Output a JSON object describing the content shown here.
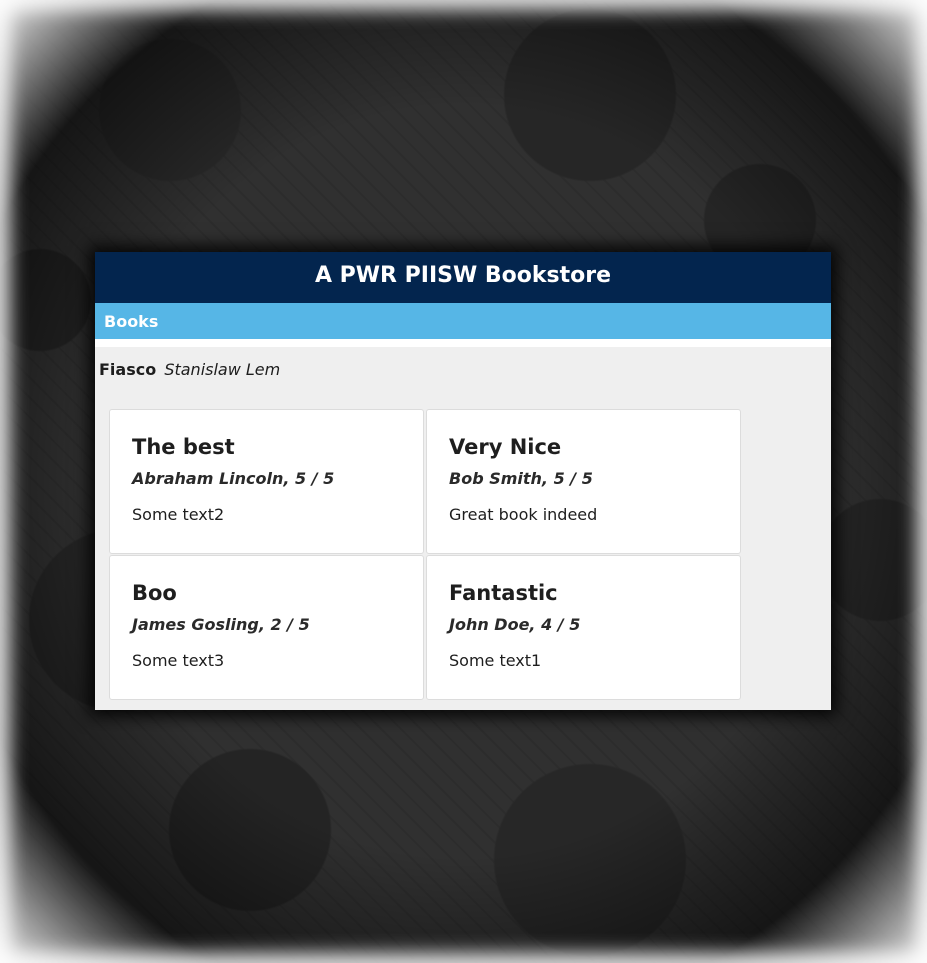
{
  "header": {
    "title": "A PWR PIISW Bookstore"
  },
  "nav": {
    "books_label": "Books"
  },
  "book": {
    "title": "Fiasco",
    "author": "Stanislaw Lem"
  },
  "reviews": [
    {
      "title": "The best",
      "author": "Abraham Lincoln",
      "rating": "Abraham Lincoln, 5 / 5",
      "text": "Some text2"
    },
    {
      "title": "Very Nice",
      "author": "Bob Smith",
      "rating": "Bob Smith, 5 / 5",
      "text": "Great book indeed"
    },
    {
      "title": "Boo",
      "author": "James Gosling",
      "rating": "James Gosling, 2 / 5",
      "text": "Some text3"
    },
    {
      "title": "Fantastic",
      "author": "John Doe",
      "rating": "John Doe, 4 / 5",
      "text": "Some text1"
    }
  ],
  "colors": {
    "header_bg": "#03254e",
    "nav_bg": "#56b6e6",
    "panel_bg": "#efefef"
  }
}
